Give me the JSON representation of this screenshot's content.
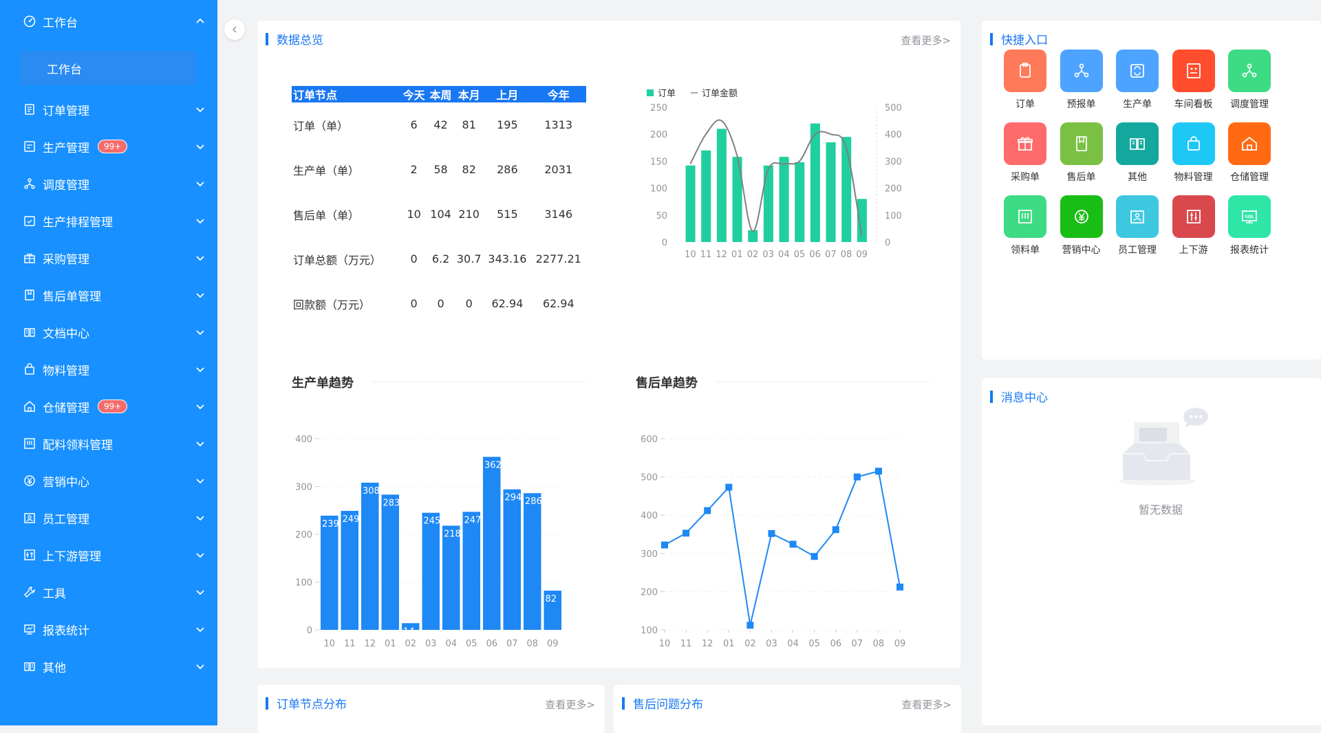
{
  "sidebar": {
    "workbench": {
      "label": "工作台",
      "sub": "工作台"
    },
    "items": [
      {
        "label": "订单管理",
        "icon": "order-icon"
      },
      {
        "label": "生产管理",
        "icon": "production-icon",
        "badge": "99+"
      },
      {
        "label": "调度管理",
        "icon": "dispatch-icon"
      },
      {
        "label": "生产排程管理",
        "icon": "schedule-icon"
      },
      {
        "label": "采购管理",
        "icon": "purchase-icon"
      },
      {
        "label": "售后单管理",
        "icon": "aftersale-icon"
      },
      {
        "label": "文档中心",
        "icon": "document-icon"
      },
      {
        "label": "物料管理",
        "icon": "material-icon"
      },
      {
        "label": "仓储管理",
        "icon": "warehouse-icon",
        "badge": "99+"
      },
      {
        "label": "配料领料管理",
        "icon": "picking-icon"
      },
      {
        "label": "营销中心",
        "icon": "marketing-icon"
      },
      {
        "label": "员工管理",
        "icon": "employee-icon"
      },
      {
        "label": "上下游管理",
        "icon": "updown-icon"
      },
      {
        "label": "工具",
        "icon": "wrench-icon"
      },
      {
        "label": "报表统计",
        "icon": "report-icon"
      },
      {
        "label": "其他",
        "icon": "other-icon"
      }
    ]
  },
  "overview": {
    "title": "数据总览",
    "more": "查看更多>",
    "table": {
      "headers": [
        "订单节点",
        "今天",
        "本周",
        "本月",
        "上月",
        "今年"
      ],
      "rows": [
        [
          "订单（单）",
          "6",
          "42",
          "81",
          "195",
          "1313"
        ],
        [
          "生产单（单）",
          "2",
          "58",
          "82",
          "286",
          "2031"
        ],
        [
          "售后单（单）",
          "10",
          "104",
          "210",
          "515",
          "3146"
        ],
        [
          "订单总额（万元）",
          "0",
          "6.2",
          "30.7",
          "343.16",
          "2277.21"
        ],
        [
          "回款额（万元）",
          "0",
          "0",
          "0",
          "62.94",
          "62.94"
        ]
      ]
    },
    "production_trend_title": "生产单趋势",
    "aftersale_trend_title": "售后单趋势"
  },
  "chart_data": [
    {
      "type": "bar",
      "categories": [
        "10",
        "11",
        "12",
        "01",
        "02",
        "03",
        "04",
        "05",
        "06",
        "07",
        "08",
        "09"
      ],
      "series": [
        {
          "name": "订单",
          "type": "bar",
          "values": [
            142,
            170,
            210,
            158,
            22,
            142,
            158,
            148,
            220,
            185,
            195,
            80
          ]
        },
        {
          "name": "订单金额",
          "type": "line",
          "axis": "right",
          "values": [
            290,
            400,
            450,
            320,
            40,
            270,
            290,
            300,
            400,
            400,
            350,
            20
          ]
        }
      ],
      "ylim": [
        0,
        250
      ],
      "yticks": [
        0,
        50,
        100,
        150,
        200,
        250
      ],
      "ylim_right": [
        0,
        500
      ],
      "yticks_right": [
        0,
        100,
        200,
        300,
        400,
        500
      ],
      "legend": "top-left"
    },
    {
      "type": "bar",
      "categories": [
        "10",
        "11",
        "12",
        "01",
        "02",
        "03",
        "04",
        "05",
        "06",
        "07",
        "08",
        "09"
      ],
      "values": [
        239,
        249,
        308,
        283,
        14,
        245,
        218,
        247,
        362,
        294,
        286,
        82
      ],
      "ylim": [
        0,
        400
      ],
      "yticks": [
        0,
        100,
        200,
        300,
        400
      ]
    },
    {
      "type": "line",
      "categories": [
        "10",
        "11",
        "12",
        "01",
        "02",
        "03",
        "04",
        "05",
        "06",
        "07",
        "08",
        "09"
      ],
      "values": [
        322,
        353,
        412,
        473,
        112,
        352,
        324,
        292,
        362,
        500,
        515,
        212
      ],
      "ylim": [
        100,
        600
      ],
      "yticks": [
        100,
        200,
        300,
        400,
        500,
        600
      ]
    }
  ],
  "quick": {
    "title": "快捷入口",
    "items": [
      {
        "label": "订单",
        "color": "#ff7a59",
        "icon": "clipboard-icon"
      },
      {
        "label": "预报单",
        "color": "#4da3ff",
        "icon": "network-icon"
      },
      {
        "label": "生产单",
        "color": "#4da3ff",
        "icon": "refresh-doc-icon"
      },
      {
        "label": "车间看板",
        "color": "#ff4d2e",
        "icon": "board-icon"
      },
      {
        "label": "调度管理",
        "color": "#3ddc84",
        "icon": "network-icon"
      },
      {
        "label": "采购单",
        "color": "#ff6b6b",
        "icon": "gift-icon"
      },
      {
        "label": "售后单",
        "color": "#7ac143",
        "icon": "bookmark-icon"
      },
      {
        "label": "其他",
        "color": "#13a89e",
        "icon": "book-icon"
      },
      {
        "label": "物料管理",
        "color": "#1ec8f5",
        "icon": "bag-icon"
      },
      {
        "label": "仓储管理",
        "color": "#ff6a13",
        "icon": "home-icon"
      },
      {
        "label": "领料单",
        "color": "#3ddc84",
        "icon": "layout-icon"
      },
      {
        "label": "营销中心",
        "color": "#19be15",
        "icon": "yen-icon"
      },
      {
        "label": "员工管理",
        "color": "#3dc8e0",
        "icon": "badge-icon"
      },
      {
        "label": "上下游",
        "color": "#d9484c",
        "icon": "sliders-icon"
      },
      {
        "label": "报表统计",
        "color": "#2ee6a6",
        "icon": "sql-icon"
      }
    ]
  },
  "messages": {
    "title": "消息中心",
    "empty": "暂无数据"
  },
  "order_nodes": {
    "title": "订单节点分布",
    "more": "查看更多>"
  },
  "aftersale_issues": {
    "title": "售后问题分布",
    "more": "查看更多>"
  }
}
